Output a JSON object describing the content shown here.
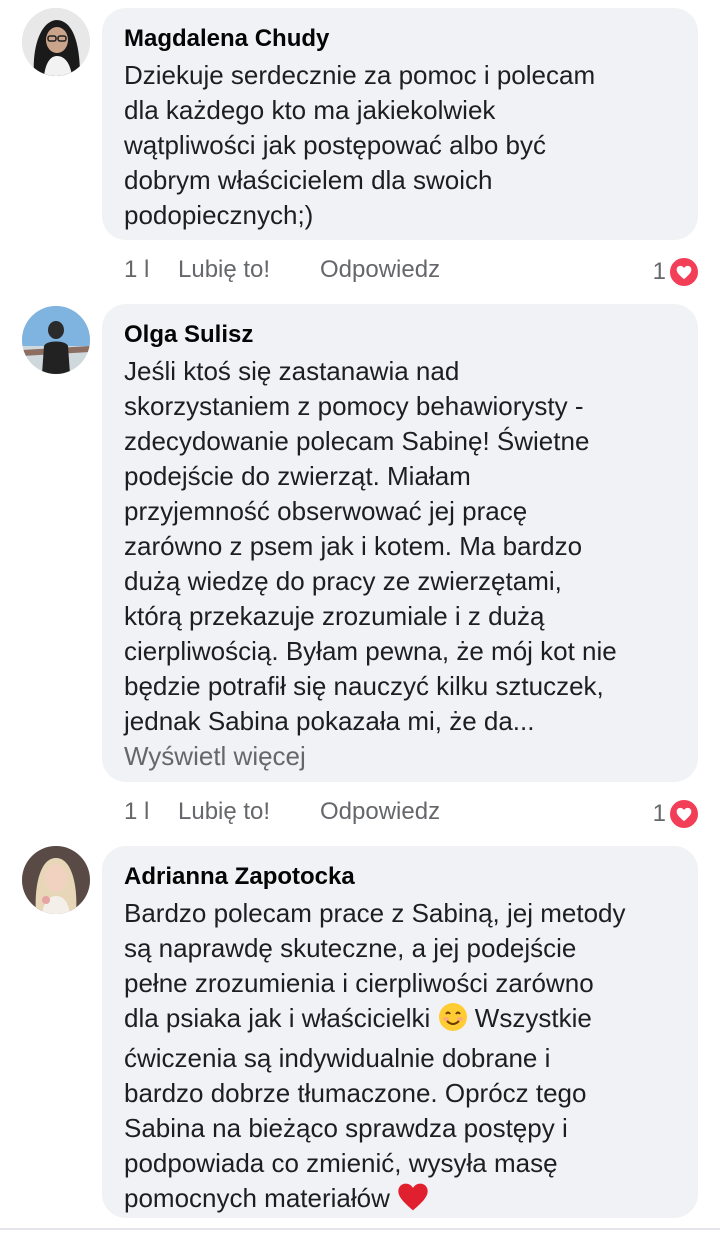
{
  "comments": [
    {
      "author": "Magdalena Chudy",
      "text": "Dziekuje serdecznie za pomoc i polecam\ndla każdego kto ma jakiekolwiek\nwątpliwości jak postępować albo być\ndobrym właścicielem dla swoich\npodopiecznych;)",
      "time": "1 l",
      "like_label": "Lubię to!",
      "reply_label": "Odpowiedz",
      "reaction_count": "1",
      "reaction_icon": "heart-icon"
    },
    {
      "author": "Olga Sulisz",
      "text": "Jeśli ktoś się zastanawia nad\nskorzystaniem z pomocy behawiorysty -\nzdecydowanie polecam Sabinę! Świetne\npodejście do zwierząt. Miałam\nprzyjemność obserwować jej pracę\nzarówno z psem jak i kotem. Ma bardzo\ndużą wiedzę do pracy ze zwierzętami,\nktórą przekazuje zrozumiale i z dużą\ncierpliwością. Byłam pewna, że mój kot nie\nbędzie potrafił się nauczyć kilku sztuczek,\njednak Sabina pokazała mi, że da...",
      "see_more": "Wyświetl więcej",
      "time": "1 l",
      "like_label": "Lubię to!",
      "reply_label": "Odpowiedz",
      "reaction_count": "1",
      "reaction_icon": "heart-icon"
    },
    {
      "author": "Adrianna Zapotocka",
      "text_part1": "Bardzo polecam prace z Sabiną, jej metody\nsą naprawdę skuteczne, a jej podejście\npełne zrozumienia i cierpliwości zarówno\ndla psiaka jak i właścicielki",
      "text_part2": " Wszystkie\nćwiczenia są indywidualnie dobrane i\nbardzo dobrze tłumaczone. Oprócz tego\nSabina na bieżąco sprawdza postępy i\npodpowiada co zmienić, wysyła masę\npomocnych materiałów ",
      "emoji_1": "smiling-face-emoji",
      "emoji_2": "red-heart-emoji"
    }
  ],
  "colors": {
    "bubble": "#f0f2f5",
    "meta_text": "#65676b",
    "heart": "#f33e58"
  }
}
